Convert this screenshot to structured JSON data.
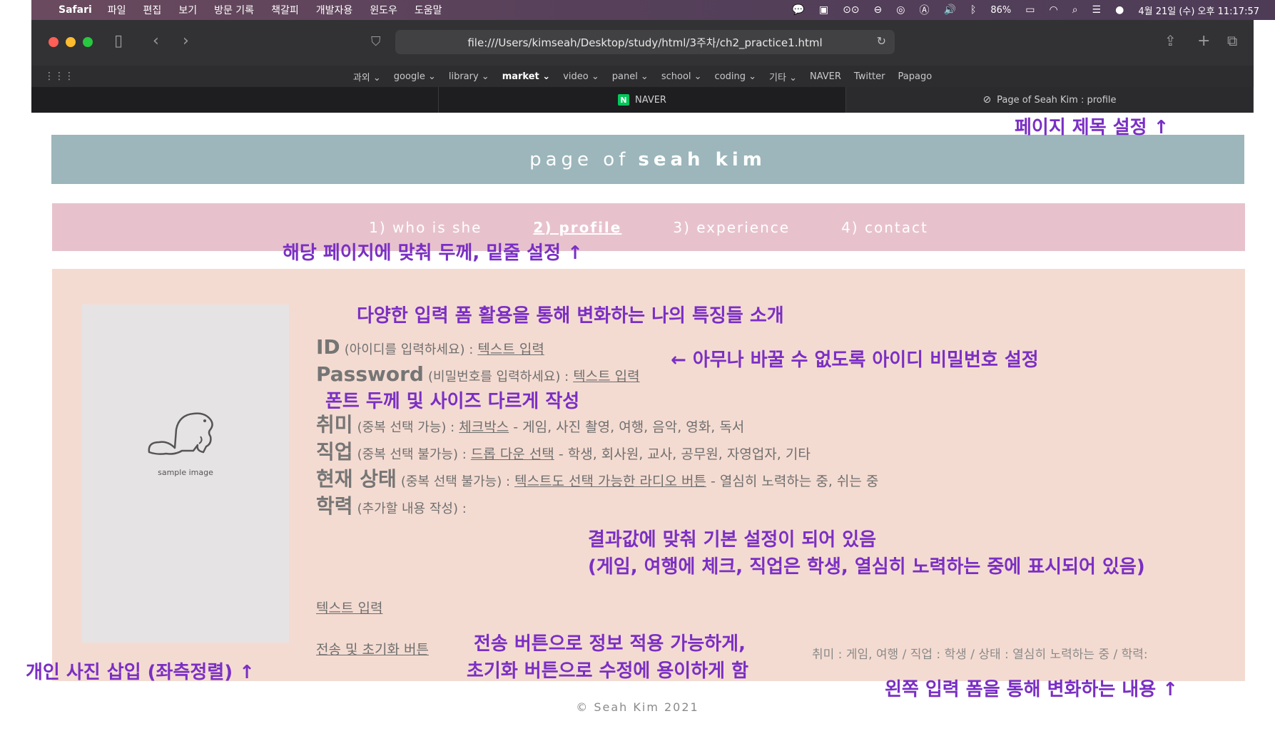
{
  "menubar": {
    "app": "Safari",
    "items": [
      "파일",
      "편집",
      "보기",
      "방문 기록",
      "책갈피",
      "개발자용",
      "윈도우",
      "도움말"
    ],
    "battery": "86%",
    "clock": "4월 21일 (수) 오후 11:17:57"
  },
  "browser": {
    "url": "file:///Users/kimseah/Desktop/study/html/3주차/ch2_practice1.html",
    "bookmarks": [
      "과외 ⌄",
      "google ⌄",
      "library ⌄",
      "market ⌄",
      "video ⌄",
      "panel ⌄",
      "school ⌄",
      "coding ⌄",
      "기타 ⌄",
      "NAVER",
      "Twitter",
      "Papago"
    ],
    "tabs": [
      {
        "label": "",
        "active": false
      },
      {
        "label": "NAVER",
        "active": false
      },
      {
        "label": "Page of Seah Kim : profile",
        "active": true
      }
    ]
  },
  "page": {
    "header_prefix": "page of",
    "header_name": "seah kim",
    "nav": [
      "1) who is she",
      "2) profile",
      "3) experience",
      "4) contact"
    ],
    "photo_caption": "sample image",
    "form": {
      "id_label": "ID",
      "id_hint": "(아이디를 입력하세요) :",
      "id_field": "텍스트 입력",
      "pw_label": "Password",
      "pw_hint": "(비밀번호를 입력하세요) :",
      "pw_field": "텍스트 입력",
      "hobby_label": "취미",
      "hobby_hint": "(중복 선택 가능) :",
      "hobby_field": "체크박스",
      "hobby_options": "- 게임, 사진 촬영, 여행, 음악, 영화, 독서",
      "job_label": "직업",
      "job_hint": "(중복 선택 불가능) :",
      "job_field": "드롭 다운 선택",
      "job_options": "- 학생, 회사원, 교사, 공무원, 자영업자, 기타",
      "status_label": "현재 상태",
      "status_hint": "(중복 선택 불가능) :",
      "status_field": "텍스트도 선택 가능한 라디오 버튼",
      "status_options": "- 열심히 노력하는 중, 쉬는 중",
      "edu_label": "학력",
      "edu_hint": "(추가할 내용 작성) :",
      "edu_field": "텍스트 입력",
      "buttons": "전송 및 초기화 버튼"
    },
    "result": "취미 : 게임, 여행 / 직업 : 학생 / 상태 : 열심히 노력하는 중 / 학력:",
    "footer": "© Seah Kim 2021"
  },
  "annotations": {
    "title_note": "페이지 제목 설정 ↑",
    "nav_note": "해당 페이지에 맞춰 두께, 밑줄 설정 ↑",
    "intro_note": "다양한 입력 폼 활용을 통해 변화하는 나의 특징들 소개",
    "idpw_note": "← 아무나 바꿀 수 없도록 아이디 비밀번호 설정",
    "font_note": "폰트 두께 및 사이즈 다르게 작성",
    "default_note_1": "결과값에 맞춰 기본 설정이 되어 있음",
    "default_note_2": "(게임, 여행에 체크, 직업은 학생, 열심히 노력하는 중에 표시되어 있음)",
    "photo_note": "개인 사진 삽입 (좌측정렬) ↑",
    "button_note_1": "전송 버튼으로 정보 적용 가능하게,",
    "button_note_2": "초기화 버튼으로 수정에 용이하게 함",
    "result_note": "왼쪽 입력 폼을 통해 변화하는 내용 ↑"
  },
  "colors": {
    "header_bg": "#9cb6bb",
    "nav_bg": "#e7c2cd",
    "panel_bg": "#f4dbd1",
    "annotation": "#7a2fc4"
  }
}
